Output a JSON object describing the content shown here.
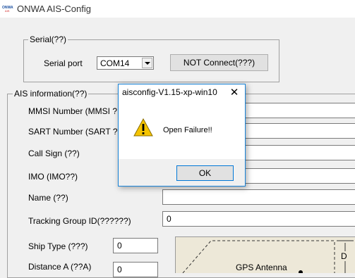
{
  "window": {
    "title": "ONWA AIS-Config",
    "logo_text": "ONWA",
    "logo_subtext": "AIS"
  },
  "serial": {
    "group_label": "Serial(??)",
    "port_label": "Serial port",
    "port_value": "COM14",
    "connect_button": "NOT Connect(???)"
  },
  "ais_info": {
    "group_label": "AIS information(??)",
    "fields": {
      "mmsi": "MMSI Number (MMSI ?",
      "sart": "SART Number (SART ?",
      "call_sign": "Call Sign (??)",
      "imo": "IMO (IMO??)",
      "name": "Name (??)",
      "tracking_group": "Tracking Group ID(??????)",
      "tracking_group_value": "0",
      "ship_type": "Ship Type (???)",
      "ship_type_value": "0",
      "distance_a": "Distance A (??A)",
      "distance_a_value": "0"
    }
  },
  "diagram": {
    "gps_label": "GPS Antenna",
    "d_label": "D"
  },
  "dialog": {
    "title": "aisconfig-V1.15-xp-win10",
    "close_glyph": "✕",
    "message": "Open Failure!!",
    "ok_button": "OK",
    "icon": "warning-icon"
  },
  "colors": {
    "dialog_border": "#1883d7",
    "warning_fill": "#f5c400",
    "diagram_bg": "#ede8d8"
  }
}
